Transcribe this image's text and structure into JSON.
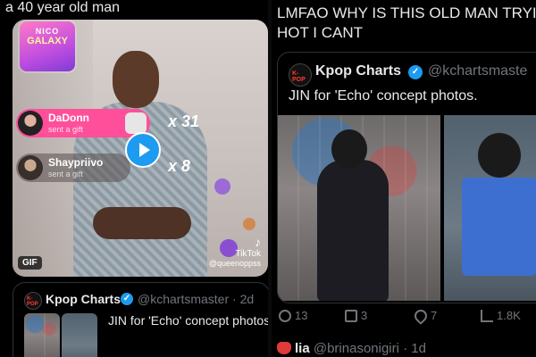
{
  "left": {
    "tweet_text": "a 40 year old man",
    "gif": {
      "badge_label": "GIF",
      "game_badge": {
        "line1": "NICO",
        "line2": "GALAXY"
      },
      "gifts": [
        {
          "name": "DaDonn",
          "sub": "sent a gift",
          "count": "x 31"
        },
        {
          "name": "Shaypriivo",
          "sub": "sent a gift",
          "count": "x 8"
        }
      ],
      "tiktok": {
        "logo": "♪",
        "name": "TikTok",
        "handle": "@queenoppss"
      }
    },
    "quote": {
      "account_name": "Kpop Charts",
      "logo_text": "K-POP",
      "verified_mark": "✓",
      "handle_time": "@kchartsmaster · 2d",
      "text": "JIN for 'Echo' concept photos."
    }
  },
  "right": {
    "tweet_text_line1": "LMFAO WHY IS THIS OLD MAN TRYIN",
    "tweet_text_line2": "HOT I CANT",
    "quote": {
      "account_name": "Kpop Charts",
      "logo_text": "K-POP",
      "verified_mark": "✓",
      "handle": "@kchartsmaste",
      "text": "JIN for 'Echo' concept photos."
    },
    "actions": {
      "replies": "13",
      "reposts": "3",
      "likes": "7",
      "views": "1.8K"
    },
    "next_tweet": {
      "name": "lia",
      "handle_time": "@brinasonigiri · 1d"
    }
  },
  "colors": {
    "background": "#000000",
    "accent_blue": "#1d9bf0",
    "muted_text": "#71767b",
    "border": "#2f3336",
    "gift_pink": "#ff4f9a"
  }
}
